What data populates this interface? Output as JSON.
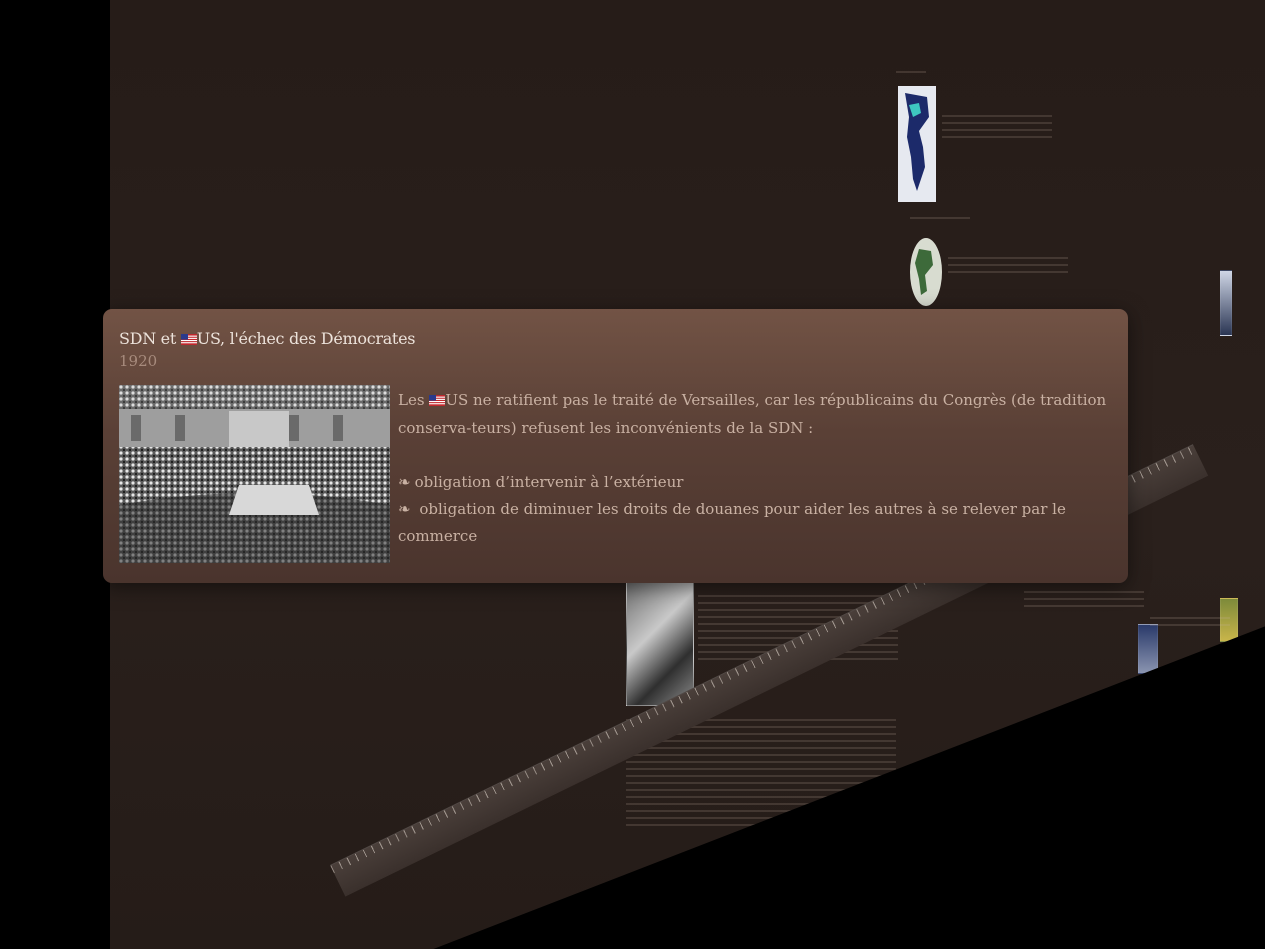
{
  "popup": {
    "title_prefix": "SDN et ",
    "title_suffix": "US, l'échec des Démocrates",
    "date": "1920",
    "photo_icon": "congress-photo",
    "body_prefix": "Les ",
    "body_suffix": "US ne ratifient pas le traité de Versailles, car les républicains du Congrès (de tradition conserva-teurs) refusent les inconvénients de la SDN :",
    "bullet_glyph": "❧",
    "items": [
      "obligation d’intervenir à l’extérieur",
      "obligation de diminuer les droits de douanes pour aider les autres à   se relever par le commerce"
    ],
    "flag_icon": "us-flag-icon"
  },
  "colors": {
    "canvas": "#2a201c",
    "card_top": "#725345",
    "card_bottom": "#4a342d",
    "title": "#ece2da",
    "date": "#a78b7d",
    "body": "#c9b1a3"
  }
}
